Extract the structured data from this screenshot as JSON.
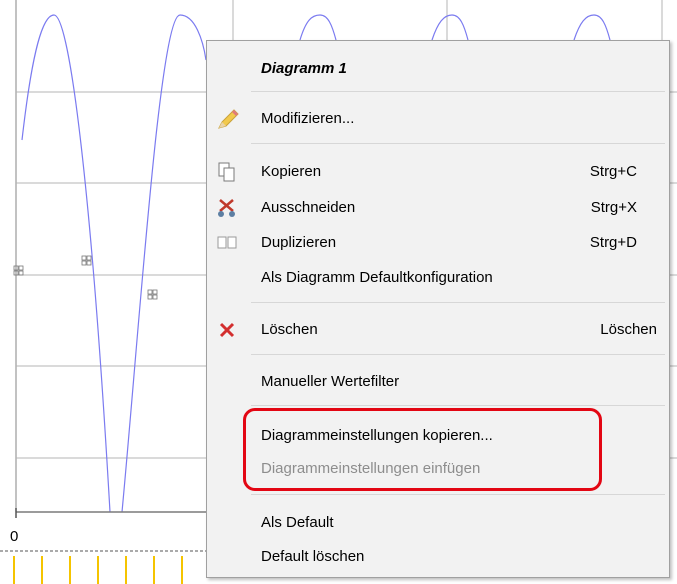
{
  "chart_area": {
    "axis_zero_label": "0",
    "curve_color": "#7b7bf0",
    "grid_color": "#b4b4b4"
  },
  "context_menu": {
    "title": "Diagramm 1",
    "modify": "Modifizieren...",
    "copy": {
      "label": "Kopieren",
      "shortcut": "Strg+C"
    },
    "cut": {
      "label": "Ausschneiden",
      "shortcut": "Strg+X"
    },
    "duplicate": {
      "label": "Duplizieren",
      "shortcut": "Strg+D"
    },
    "as_default_config": "Als Diagramm Defaultkonfiguration",
    "delete": {
      "label": "Löschen",
      "shortcut": "Löschen"
    },
    "manual_filter": "Manueller Wertefilter",
    "copy_settings": "Diagrammeinstellungen kopieren...",
    "paste_settings": "Diagrammeinstellungen einfügen",
    "as_default": "Als Default",
    "delete_default": "Default löschen"
  },
  "icons": {
    "modify": "pencil-icon",
    "copy": "copy-icon",
    "cut": "scissors-icon",
    "duplicate": "duplicate-icon",
    "delete": "delete-x-icon"
  },
  "highlight_color": "#e30613"
}
